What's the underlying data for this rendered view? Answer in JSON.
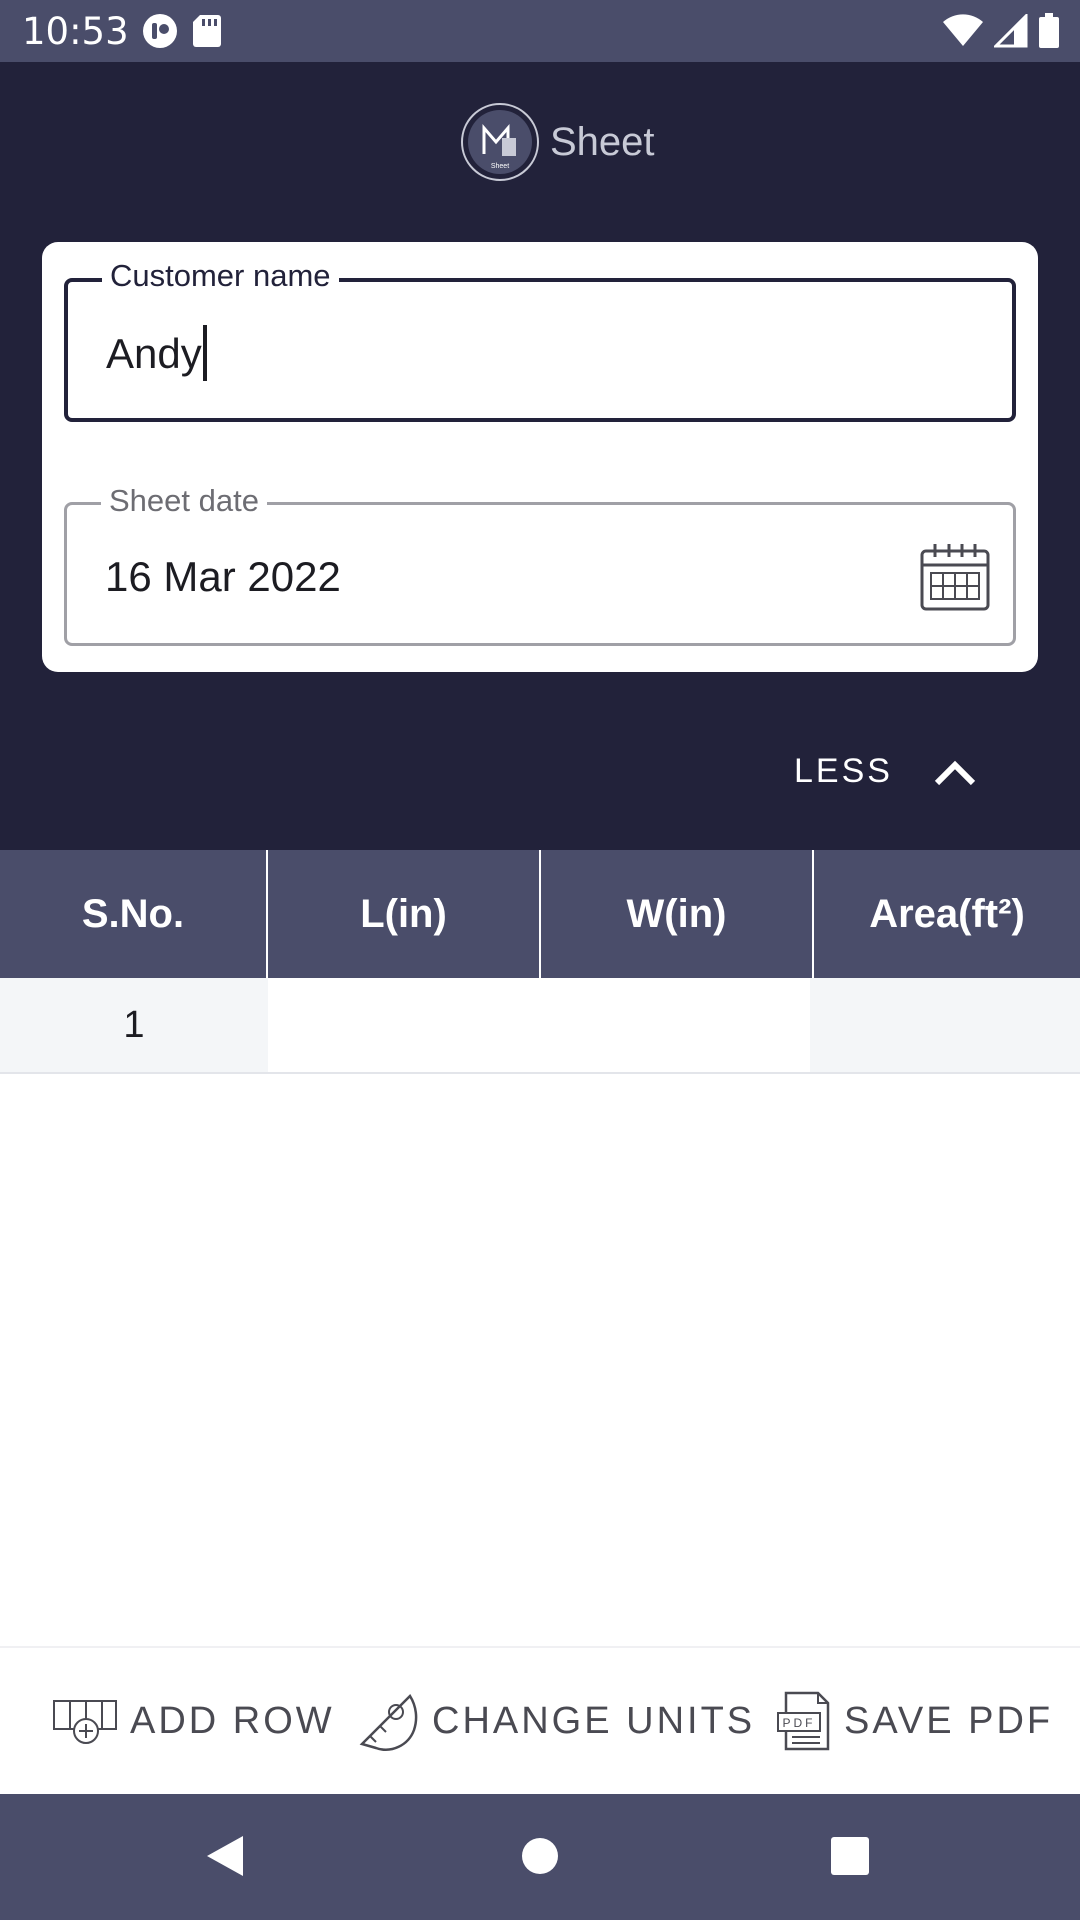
{
  "status_bar": {
    "time": "10:53",
    "left_icons": [
      "app-notification-icon",
      "sd-card-icon"
    ],
    "right_icons": [
      "wifi-icon",
      "signal-icon",
      "battery-icon"
    ]
  },
  "header": {
    "app_title": "Sheet",
    "logo_text": "Sheet"
  },
  "form": {
    "customer_name_label": "Customer name",
    "customer_name_value": "Andy",
    "sheet_date_label": "Sheet date",
    "sheet_date_value": "16 Mar 2022",
    "toggle_label": "LESS"
  },
  "table": {
    "columns": [
      "S.No.",
      "L(in)",
      "W(in)",
      "Area(ft²)"
    ],
    "rows": [
      {
        "sno": "1",
        "length": "",
        "width": "",
        "area": ""
      }
    ]
  },
  "toolbar": {
    "add_row": "ADD ROW",
    "change_units": "CHANGE UNITS",
    "save_pdf": "SAVE PDF",
    "pdf_icon_text": "PDF"
  },
  "colors": {
    "header_bg": "#22223a",
    "table_header_bg": "#4a4d6a",
    "status_bar_bg": "#4a4d6a"
  }
}
